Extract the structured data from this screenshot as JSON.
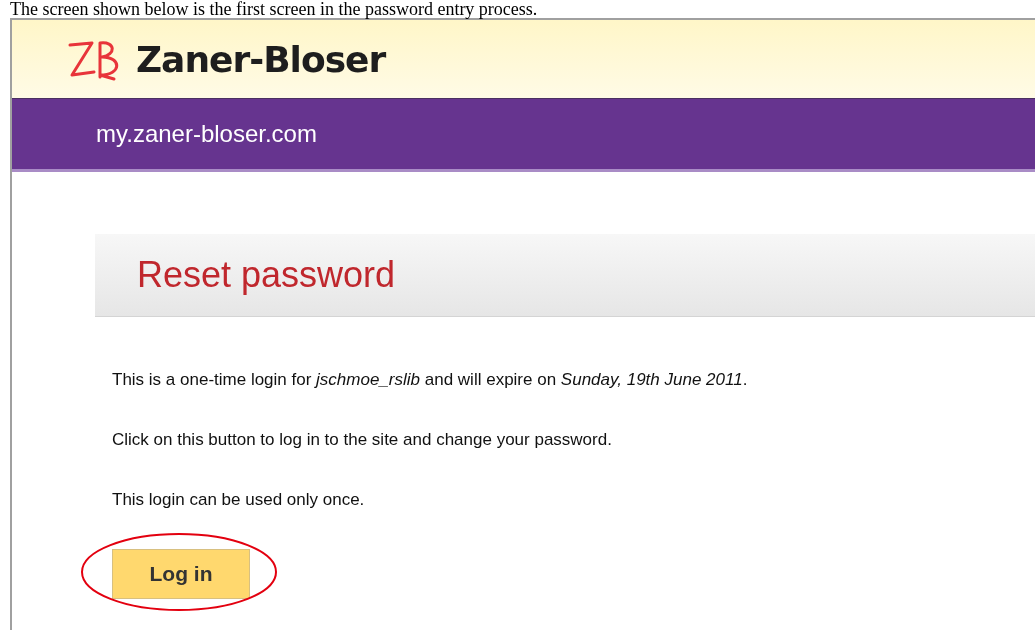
{
  "caption": "The screen shown below is the first screen in the password entry process.",
  "site": {
    "brand": "Zaner-Bloser",
    "domain": "my.zaner-bloser.com"
  },
  "page_title": "Reset password",
  "paragraphs": [
    "This is a one-time login for *jschmoe_rslib* and will expire on *Sunday, 19th June 2011*.",
    "Click on this button to log in to the site and change your password.",
    "This login can be used only once."
  ],
  "button": {
    "label": "Log in",
    "highlighted": true
  }
}
